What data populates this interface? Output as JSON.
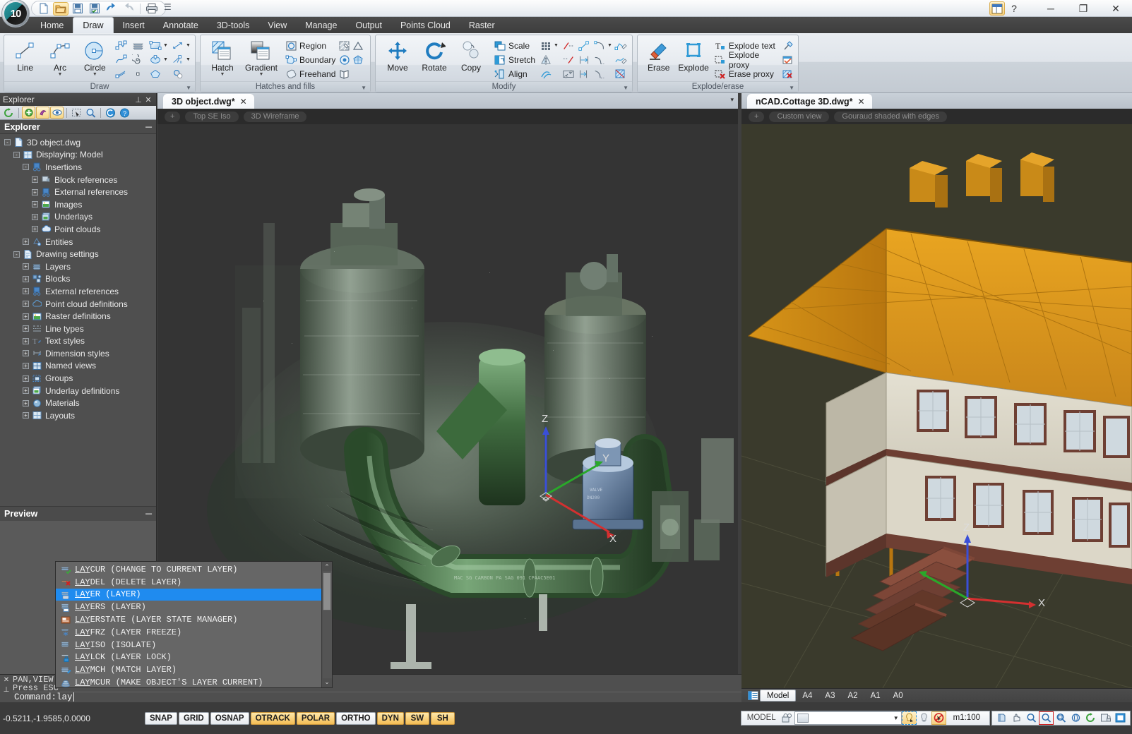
{
  "app": {
    "title_logo": "10",
    "quick_access": [
      {
        "name": "new-file-icon",
        "label": "New"
      },
      {
        "name": "open-folder-icon",
        "label": "Open",
        "selected": true
      },
      {
        "name": "save-icon",
        "label": "Save"
      },
      {
        "name": "save-all-icon",
        "label": "Save All"
      },
      {
        "name": "undo-icon",
        "label": "Undo"
      },
      {
        "name": "redo-icon",
        "label": "Redo"
      },
      {
        "name": "print-icon",
        "label": "Print"
      }
    ],
    "qat_overflow": "☰",
    "window_buttons": {
      "minimize": "─",
      "maximize": "❐",
      "close": "✕"
    },
    "help_label": "?"
  },
  "ribbon": {
    "tabs": [
      {
        "label": "Home",
        "active": false
      },
      {
        "label": "Draw",
        "active": true
      },
      {
        "label": "Insert",
        "active": false
      },
      {
        "label": "Annotate",
        "active": false
      },
      {
        "label": "3D-tools",
        "active": false
      },
      {
        "label": "View",
        "active": false
      },
      {
        "label": "Manage",
        "active": false
      },
      {
        "label": "Output",
        "active": false
      },
      {
        "label": "Points Cloud",
        "active": false
      },
      {
        "label": "Raster",
        "active": false
      }
    ],
    "panels": [
      {
        "title": "Draw",
        "big": [
          {
            "label": "Line",
            "icon": "line-icon",
            "dropdown": false
          },
          {
            "label": "Arc",
            "icon": "arc-icon",
            "dropdown": true
          },
          {
            "label": "Circle",
            "icon": "circle-icon",
            "dropdown": true
          }
        ],
        "small_icons": [
          "polyline-icon",
          "spline-icon",
          "multiline-icon",
          "revision-cloud-icon",
          "spiral-icon",
          "point-icon",
          "rectangle-icon",
          "ellipse-icon",
          "polygon-icon",
          "ray-icon",
          "construction-line-icon",
          "donut-icon"
        ]
      },
      {
        "title": "Hatches and fills",
        "big": [
          {
            "label": "Hatch",
            "icon": "hatch-icon",
            "dropdown": true
          },
          {
            "label": "Gradient",
            "icon": "gradient-icon",
            "dropdown": true
          }
        ],
        "items": [
          {
            "label": "Region",
            "icon": "region-icon"
          },
          {
            "label": "Boundary",
            "icon": "boundary-icon"
          },
          {
            "label": "Freehand",
            "icon": "freehand-icon"
          }
        ],
        "small_icons": [
          "hatch-edit-icon",
          "solid-fill-icon",
          "wipeout-icon",
          "gradient-edit-icon",
          "mask-icon",
          "hatch-map-icon"
        ]
      },
      {
        "title": "Modify",
        "big": [
          {
            "label": "Move",
            "icon": "move-icon",
            "dropdown": false
          },
          {
            "label": "Rotate",
            "icon": "rotate-icon",
            "dropdown": false
          },
          {
            "label": "Copy",
            "icon": "copy-icon",
            "dropdown": false
          }
        ],
        "items": [
          {
            "label": "Scale",
            "icon": "scale-icon"
          },
          {
            "label": "Stretch",
            "icon": "stretch-icon"
          },
          {
            "label": "Align",
            "icon": "align-icon"
          }
        ],
        "small_icons": [
          "array-icon",
          "mirror-icon",
          "offset-icon",
          "trim-icon",
          "extend-icon",
          "break-icon",
          "lengthen-icon",
          "break-at-point-icon",
          "join-icon",
          "fillet-icon",
          "chamfer-icon",
          "blend-icon",
          "edit-polyline-icon",
          "edit-spline-icon",
          "edit-hatch-icon"
        ]
      },
      {
        "title": "Explode/erase",
        "big": [
          {
            "label": "Erase",
            "icon": "erase-icon",
            "dropdown": false
          },
          {
            "label": "Explode",
            "icon": "explode-icon",
            "dropdown": false
          }
        ],
        "items": [
          {
            "label": "Explode text",
            "icon": "explode-text-icon"
          },
          {
            "label": "Explode proxy",
            "icon": "explode-proxy-icon"
          },
          {
            "label": "Erase proxy",
            "icon": "erase-proxy-icon"
          }
        ],
        "small_icons": [
          "purge-icon",
          "overkill-icon",
          "delete-duplicates-icon"
        ]
      }
    ]
  },
  "explorer": {
    "caption": "Explorer",
    "pin_glyph": "⚓",
    "close_glyph": "✕",
    "toolbar": [
      {
        "name": "refresh-icon",
        "on": false
      },
      {
        "name": "new-layer-icon",
        "on": true
      },
      {
        "name": "rename-icon",
        "on": true
      },
      {
        "name": "visibility-icon",
        "on": true
      },
      {
        "name": "select-all-icon",
        "on": false
      },
      {
        "name": "zoom-select-icon",
        "on": false
      },
      {
        "name": "undo-explorer-icon",
        "on": false
      },
      {
        "name": "help-explorer-icon",
        "on": false
      }
    ],
    "header": "Explorer",
    "minimize_glyph": "─",
    "tree": [
      {
        "label": "3D object.dwg",
        "depth": 0,
        "box": "-",
        "icon": "dwg-file-icon"
      },
      {
        "label": "Displaying: Model",
        "depth": 1,
        "box": "-",
        "icon": "model-icon"
      },
      {
        "label": "Insertions",
        "depth": 2,
        "box": "-",
        "icon": "insertions-icon"
      },
      {
        "label": "Block references",
        "depth": 3,
        "box": "+",
        "icon": "block-reference-icon"
      },
      {
        "label": "External references",
        "depth": 3,
        "box": "+",
        "icon": "xref-icon"
      },
      {
        "label": "Images",
        "depth": 3,
        "box": "+",
        "icon": "image-icon"
      },
      {
        "label": "Underlays",
        "depth": 3,
        "box": "+",
        "icon": "underlay-icon"
      },
      {
        "label": "Point clouds",
        "depth": 3,
        "box": "+",
        "icon": "point-cloud-icon"
      },
      {
        "label": "Entities",
        "depth": 2,
        "box": "+",
        "icon": "entities-icon"
      },
      {
        "label": "Drawing settings",
        "depth": 1,
        "box": "-",
        "icon": "drawing-settings-icon"
      },
      {
        "label": "Layers",
        "depth": 2,
        "box": "+",
        "icon": "layers-icon"
      },
      {
        "label": "Blocks",
        "depth": 2,
        "box": "+",
        "icon": "blocks-icon"
      },
      {
        "label": "External references",
        "depth": 2,
        "box": "+",
        "icon": "xref-icon"
      },
      {
        "label": "Point cloud definitions",
        "depth": 2,
        "box": "+",
        "icon": "point-cloud-def-icon"
      },
      {
        "label": "Raster definitions",
        "depth": 2,
        "box": "+",
        "icon": "raster-def-icon"
      },
      {
        "label": "Line types",
        "depth": 2,
        "box": "+",
        "icon": "line-types-icon"
      },
      {
        "label": "Text styles",
        "depth": 2,
        "box": "+",
        "icon": "text-styles-icon"
      },
      {
        "label": "Dimension styles",
        "depth": 2,
        "box": "+",
        "icon": "dimension-styles-icon"
      },
      {
        "label": "Named views",
        "depth": 2,
        "box": "+",
        "icon": "named-views-icon"
      },
      {
        "label": "Groups",
        "depth": 2,
        "box": "+",
        "icon": "groups-icon"
      },
      {
        "label": "Underlay definitions",
        "depth": 2,
        "box": "+",
        "icon": "underlay-def-icon"
      },
      {
        "label": "Materials",
        "depth": 2,
        "box": "+",
        "icon": "materials-icon"
      },
      {
        "label": "Layouts",
        "depth": 2,
        "box": "+",
        "icon": "layouts-icon"
      }
    ],
    "preview": {
      "header": "Preview",
      "minimize_glyph": "─"
    }
  },
  "documents": {
    "left": {
      "tab_label": "3D object.dwg*",
      "close_glyph": "✕",
      "overflow_glyph": "▾",
      "viewport_chips": [
        {
          "label": "+",
          "name": "add-viewconfig-chip"
        },
        {
          "label": "Top SE Iso",
          "name": "view-preset-chip"
        },
        {
          "label": "3D Wireframe",
          "name": "visual-style-chip"
        }
      ],
      "ucs_axes": [
        "Z",
        "Y",
        "X"
      ]
    },
    "right": {
      "tab_label": "nCAD.Cottage 3D.dwg*",
      "close_glyph": "✕",
      "viewport_chips": [
        {
          "label": "+",
          "name": "add-viewconfig-chip"
        },
        {
          "label": "Custom view",
          "name": "view-preset-chip"
        },
        {
          "label": "Gouraud shaded with edges",
          "name": "visual-style-chip"
        }
      ],
      "ucs_axes": [
        "Z",
        "X"
      ],
      "layout_tabs": [
        {
          "label": "Model",
          "active": true
        },
        {
          "label": "A4",
          "active": false
        },
        {
          "label": "A3",
          "active": false
        },
        {
          "label": "A2",
          "active": false
        },
        {
          "label": "A1",
          "active": false
        },
        {
          "label": "A0",
          "active": false
        }
      ],
      "layout_menu_icon": "layout-list-icon"
    }
  },
  "autocomplete": {
    "items": [
      {
        "prefix": "LAY",
        "rest": "CUR",
        "desc": "(CHANGE TO CURRENT LAYER)",
        "icon": "layer-current-icon",
        "selected": false
      },
      {
        "prefix": "LAY",
        "rest": "DEL",
        "desc": "(DELETE LAYER)",
        "icon": "layer-delete-icon",
        "selected": false
      },
      {
        "prefix": "LAY",
        "rest": "ER",
        "desc": "(LAYER)",
        "icon": "layer-icon",
        "selected": true
      },
      {
        "prefix": "LAY",
        "rest": "ERS",
        "desc": "(LAYER)",
        "icon": "layers-list-icon",
        "selected": false
      },
      {
        "prefix": "LAY",
        "rest": "ERSTATE",
        "desc": "(LAYER STATE MANAGER)",
        "icon": "layer-state-icon",
        "selected": false
      },
      {
        "prefix": "LAY",
        "rest": "FRZ",
        "desc": "(LAYER FREEZE)",
        "icon": "layer-freeze-icon",
        "selected": false
      },
      {
        "prefix": "LAY",
        "rest": "ISO",
        "desc": "(ISOLATE)",
        "icon": "layer-isolate-icon",
        "selected": false
      },
      {
        "prefix": "LAY",
        "rest": "LCK",
        "desc": "(LAYER LOCK)",
        "icon": "layer-lock-icon",
        "selected": false
      },
      {
        "prefix": "LAY",
        "rest": "MCH",
        "desc": "(MATCH LAYER)",
        "icon": "layer-match-icon",
        "selected": false
      },
      {
        "prefix": "LAY",
        "rest": "MCUR",
        "desc": "(MAKE OBJECT'S LAYER CURRENT)",
        "icon": "layer-make-current-icon",
        "selected": false
      }
    ],
    "scroll_up_glyph": "⌃",
    "scroll_down_glyph": "⌄"
  },
  "command_line": {
    "history": [
      "PAN,VIEW",
      "Press ESC"
    ],
    "prompt": "Command: ",
    "input_value": "lay",
    "close_glyph": "✕",
    "pin_glyph": "⚓"
  },
  "status_bar": {
    "coordinates": "-0.5211,-1.9585,0.0000",
    "toggles": [
      {
        "label": "SNAP",
        "on": false
      },
      {
        "label": "GRID",
        "on": false
      },
      {
        "label": "OSNAP",
        "on": false
      },
      {
        "label": "OTRACK",
        "on": true
      },
      {
        "label": "POLAR",
        "on": true
      },
      {
        "label": "ORTHO",
        "on": false
      },
      {
        "label": "DYN",
        "on": true
      },
      {
        "label": "SW",
        "on": true
      },
      {
        "label": "SH",
        "on": true
      }
    ],
    "space_label": "MODEL",
    "layer_combo_value": "",
    "scale_label": "m1:100",
    "right_icons": [
      {
        "name": "lock-ucs-icon",
        "on": false
      },
      {
        "name": "layer-swatch-icon",
        "on": false
      },
      {
        "name": "layer-isolate-status-icon",
        "on": true
      },
      {
        "name": "lightbulb-icon",
        "on": false
      },
      {
        "name": "no-select-icon",
        "on": true
      },
      {
        "name": "clean-screen-icon",
        "on": false
      },
      {
        "name": "pan-hand-icon",
        "on": false
      },
      {
        "name": "zoom-realtime-icon",
        "on": false
      },
      {
        "name": "zoom-window-icon",
        "on": true
      },
      {
        "name": "zoom-extents-icon",
        "on": false
      },
      {
        "name": "orbit-icon",
        "on": false
      },
      {
        "name": "refresh-view-icon",
        "on": false
      },
      {
        "name": "lock-toolbars-icon",
        "on": false
      },
      {
        "name": "full-screen-icon",
        "on": false
      }
    ]
  },
  "colors": {
    "accent_blue": "#1f8bef",
    "ribbon_bg": "#dfe4ea",
    "dark_chrome": "#3f3f3f",
    "panel_dark": "#4f4f4f",
    "toggle_on": "#f4bd54",
    "roof_orange": "#d99a1e",
    "wall_cream": "#d8d4c6"
  }
}
